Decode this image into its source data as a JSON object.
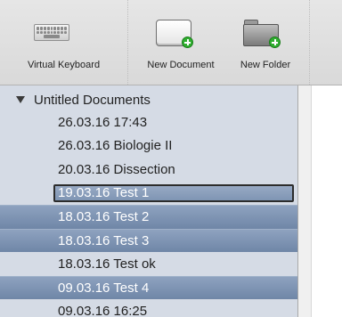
{
  "toolbar": {
    "items": [
      {
        "label": "Virtual Keyboard",
        "icon": "keyboard-icon"
      },
      {
        "label": "New Document",
        "icon": "new-document-icon"
      },
      {
        "label": "New Folder",
        "icon": "new-folder-icon"
      }
    ]
  },
  "sidebar": {
    "group": {
      "label": "Untitled Documents",
      "expanded": true
    },
    "documents": [
      {
        "label": "26.03.16 17:43",
        "selected": false
      },
      {
        "label": "26.03.16 Biologie II",
        "selected": false
      },
      {
        "label": "20.03.16 Dissection",
        "selected": false
      },
      {
        "label": "19.03.16 Test 1",
        "selected": true,
        "editing": true
      },
      {
        "label": "18.03.16 Test 2",
        "selected": true
      },
      {
        "label": "18.03.16 Test 3",
        "selected": true
      },
      {
        "label": "18.03.16 Test ok",
        "selected": false
      },
      {
        "label": "09.03.16 Test 4",
        "selected": true
      },
      {
        "label": "09.03.16 16:25",
        "selected": false
      }
    ]
  },
  "colors": {
    "selection": "#7a8fae",
    "sidebar_bg": "#d5dbe5",
    "accent_plus": "#2fae2f"
  }
}
